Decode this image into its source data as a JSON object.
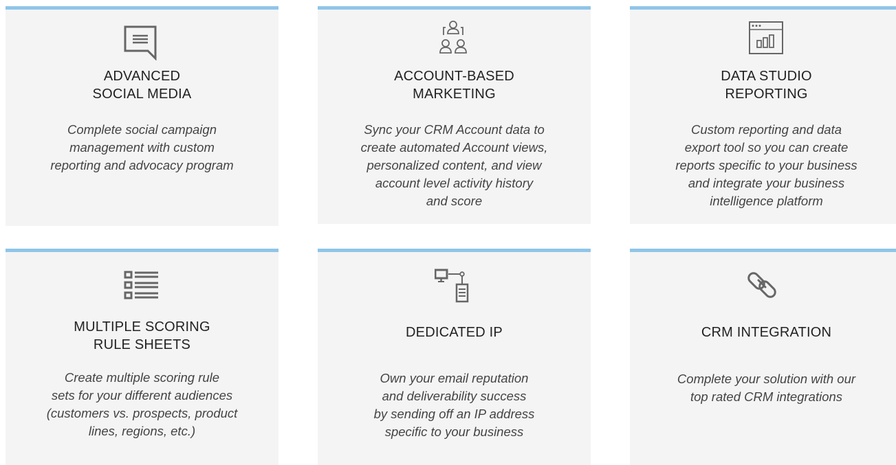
{
  "colors": {
    "card_background": "#f4f4f4",
    "accent_bar": "#8fc5e9",
    "icon": "#666666",
    "title": "#222222",
    "description": "#444444"
  },
  "features": [
    {
      "icon": "chat-bubble-icon",
      "title": "ADVANCED\nSOCIAL MEDIA",
      "description": "Complete social campaign\nmanagement with custom\nreporting and advocacy program"
    },
    {
      "icon": "account-group-icon",
      "title": "ACCOUNT-BASED\nMARKETING",
      "description": "Sync your CRM Account data to\ncreate automated Account views,\npersonalized content, and view\naccount level activity history\nand score"
    },
    {
      "icon": "report-window-icon",
      "title": "DATA STUDIO\nREPORTING",
      "description": "Custom reporting and data\nexport tool so you can create\nreports specific to your business\nand integrate your business\nintelligence platform"
    },
    {
      "icon": "checklist-icon",
      "title": "MULTIPLE SCORING\nRULE SHEETS",
      "description": "Create multiple scoring rule\nsets for your different audiences\n(customers vs. prospects, product\nlines, regions, etc.)"
    },
    {
      "icon": "monitor-server-icon",
      "title": "DEDICATED IP",
      "description": "Own your email reputation\nand deliverability success\nby sending off an IP address\nspecific to your business"
    },
    {
      "icon": "chain-link-icon",
      "title": "CRM INTEGRATION",
      "description": "Complete your solution with our\ntop rated CRM integrations"
    }
  ]
}
